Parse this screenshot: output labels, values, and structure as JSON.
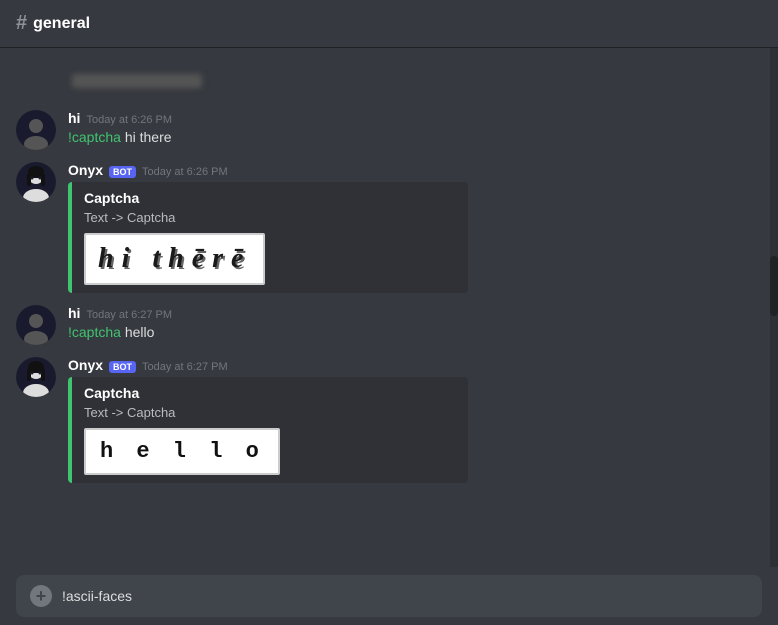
{
  "header": {
    "hash": "#",
    "channel_name": "general"
  },
  "messages": [
    {
      "id": "blurred",
      "type": "blurred"
    },
    {
      "id": "msg1",
      "type": "user",
      "username": "hi",
      "timestamp": "Today at 6:26 PM",
      "text": "!captcha hi there",
      "cmd_part": "!captcha",
      "content_part": " hi there"
    },
    {
      "id": "msg2",
      "type": "bot",
      "username": "Onyx",
      "bot_label": "BOT",
      "timestamp": "Today at 6:26 PM",
      "embed": {
        "title": "Captcha",
        "desc": "Text -> Captcha",
        "captcha_type": "hi_there"
      }
    },
    {
      "id": "msg3",
      "type": "user",
      "username": "hi",
      "timestamp": "Today at 6:27 PM",
      "text": "!captcha hello",
      "cmd_part": "!captcha",
      "content_part": " hello"
    },
    {
      "id": "msg4",
      "type": "bot",
      "username": "Onyx",
      "bot_label": "BOT",
      "timestamp": "Today at 6:27 PM",
      "embed": {
        "title": "Captcha",
        "desc": "Text -> Captcha",
        "captcha_type": "hello"
      }
    }
  ],
  "input": {
    "placeholder": "!ascii-faces"
  }
}
